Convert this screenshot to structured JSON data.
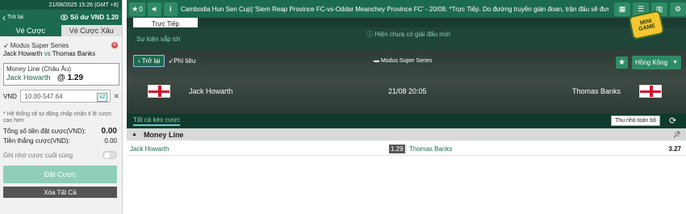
{
  "left_panel": {
    "datetime": "21/08/2025 15:26 (GMT +8)",
    "back_label": "Trở lại",
    "balance": "Số dư VND 1.20",
    "tabs": [
      "Vé Cược",
      "Vé Cược Xâu"
    ],
    "bet": {
      "league": "Modus Super Series",
      "home": "Jack Howarth",
      "vs": "vs",
      "away": "Thomas Banks",
      "market": "Money Line (Châu Âu)",
      "pick": "Jack Howarth",
      "odds": "@ 1.29"
    },
    "stake": {
      "label": "VND",
      "placeholder": "10.00-547.64",
      "multiplier": "x2"
    },
    "note": "* Hệ thống sẽ tự động chấp nhận tỉ lệ cược cao hơn",
    "total_stake_label": "Tổng số tiền đặt cược(VND):",
    "total_stake_value": "0.00",
    "win_label": "Tiền thắng cược(VND):",
    "win_value": "0.00",
    "remember_label": "Ghi nhớ cược cuối cùng",
    "place_bet": "Đặt Cược",
    "clear_all": "Xóa Tất Cả"
  },
  "topbar": {
    "counter": "0",
    "marquee": "Cambodia Hun Sen Cup] 'Siem Reap Province FC-vs-Oddar Meanchey Province FC' - 20/08. *Trực Tiếp. Do đường truyền gián đoan, trận đấu sẽ được"
  },
  "tabs": {
    "live": "Trực Tiếp",
    "events": "Sự kiện sắp tới",
    "notice": "Hiện chưa có giải đấu mới"
  },
  "minigame": {
    "line1": "MINI",
    "line2": "GAME"
  },
  "match": {
    "back": "Trở lại",
    "stats": "Phí tiêu",
    "league": "Modus Super Series",
    "region": "Hồng Kông",
    "home": "Jack Howarth",
    "datetime": "21/08 20:05",
    "away": "Thomas Banks"
  },
  "markets": {
    "all_tab": "Tất cả kèo cược",
    "collapse": "Thu nhỏ toàn bộ",
    "section": "Money Line",
    "rows": [
      {
        "home": "Jack Howarth",
        "home_odds": "1.29",
        "away": "Thomas Banks",
        "away_odds": "3.27"
      }
    ]
  },
  "colors": {
    "brand": "#1d6b4f",
    "accent": "#2e8b66",
    "place_bet": "#8fcfb7"
  }
}
